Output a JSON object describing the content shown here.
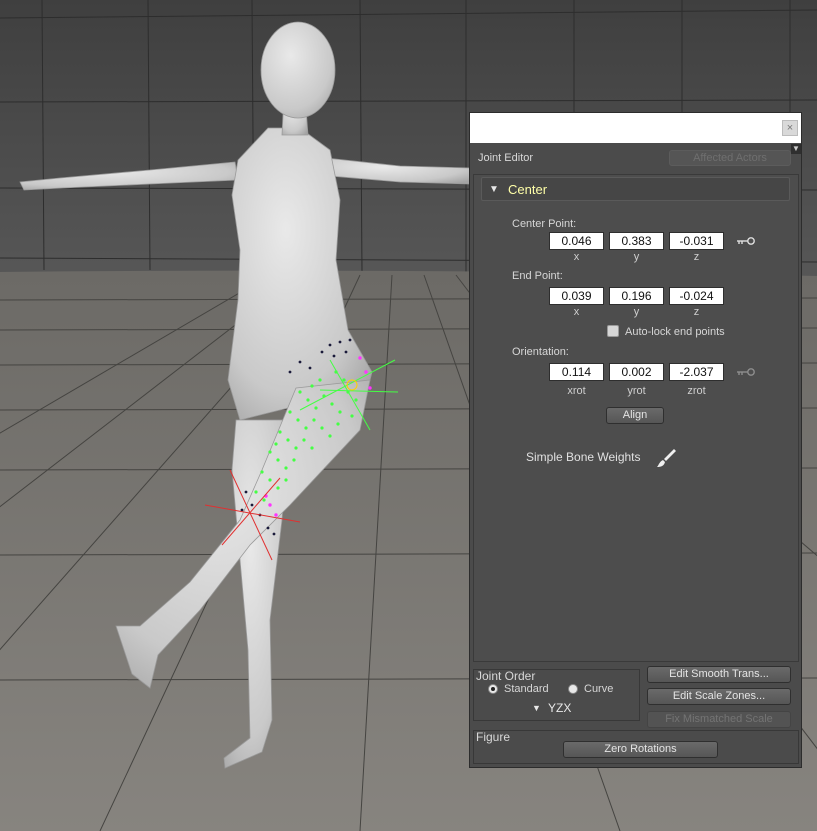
{
  "panel": {
    "title": "Joint Editor",
    "affected_actors_label": "Affected Actors",
    "close_glyph": "×",
    "menu_glyph": "▼"
  },
  "center": {
    "section_title": "Center",
    "center_point_label": "Center Point:",
    "center_point": {
      "x": "0.046",
      "y": "0.383",
      "z": "-0.031"
    },
    "end_point_label": "End Point:",
    "end_point": {
      "x": "0.039",
      "y": "0.196",
      "z": "-0.024"
    },
    "axis_labels": {
      "x": "x",
      "y": "y",
      "z": "z"
    },
    "auto_lock_label": "Auto-lock end points",
    "orientation_label": "Orientation:",
    "orientation": {
      "xrot": "0.114",
      "yrot": "0.002",
      "zrot": "-2.037"
    },
    "rot_labels": {
      "x": "xrot",
      "y": "yrot",
      "z": "zrot"
    },
    "align_label": "Align",
    "simple_bone_weights_label": "Simple Bone Weights"
  },
  "joint_order": {
    "title": "Joint Order",
    "standard_label": "Standard",
    "curve_label": "Curve",
    "selected": "standard",
    "order_value": "YZX"
  },
  "buttons": {
    "edit_smooth": "Edit Smooth Trans...",
    "edit_scale": "Edit Scale Zones...",
    "fix_mismatched": "Fix Mismatched Scale"
  },
  "figure": {
    "title": "Figure",
    "zero_rotations": "Zero Rotations"
  },
  "icons": {
    "key": "key-icon",
    "brush": "paint-brush-icon",
    "expand": "triangle-down-icon"
  },
  "colors": {
    "panel_bg": "#4b4b4b",
    "section_title": "#ffffa8",
    "weight_green": "#44ff44",
    "weight_magenta": "#ff33ff",
    "joint_red": "#e03030"
  }
}
